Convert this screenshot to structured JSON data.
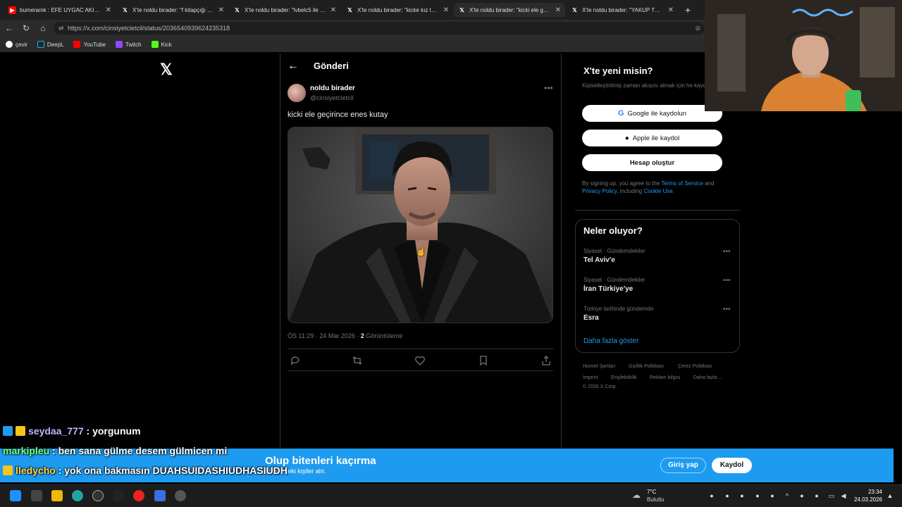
{
  "browser": {
    "tabs": [
      {
        "label": "bumeramk : EFE UYGAC AKIMI TEK",
        "icon": "youtube-icon"
      },
      {
        "label": "X'te noldu birader: \"f kitapçığı ...",
        "icon": "x-icon"
      },
      {
        "label": "X'te noldu birader: \"lvbelc5 ile kon",
        "icon": "x-icon"
      },
      {
        "label": "X'te noldu birader: \"kicke kız tayfa",
        "icon": "x-icon"
      },
      {
        "label": "X'te noldu birader: \"kicki ele geçir",
        "icon": "x-icon"
      },
      {
        "label": "X'te noldu birader: \"YAKUP TV ENL",
        "icon": "x-icon"
      }
    ],
    "new_tab": "+",
    "url": "https://x.com/cinsiyetcietcil/status/2036540939624235318",
    "bookmarks": [
      {
        "label": "çevir",
        "color": "#ffffff"
      },
      {
        "label": "DeepL",
        "color": "#0f2b46"
      },
      {
        "label": "YouTube",
        "color": "#ff0000"
      },
      {
        "label": "Twitch",
        "color": "#9146ff"
      },
      {
        "label": "Kick",
        "color": "#53fc18"
      }
    ]
  },
  "post": {
    "heading": "Gönderi",
    "author_name": "noldu birader",
    "author_handle": "@cinsiyetcietcil",
    "text": "kicki ele geçirince enes kutay",
    "time_date": "ÖS 11:29 · 24 Mar 2026 · ",
    "views_count": "2",
    "views_label": " Görüntüleme"
  },
  "signup": {
    "title": "X'te yeni misin?",
    "desc": "Kişiselleştirilmiş zaman akışını almak için he kaydol!",
    "google_label": "Google ile kaydolun",
    "apple_label": "Apple ile kaydol",
    "create_label": "Hesap oluştur",
    "terms_prefix": "By signing up, you agree to the ",
    "terms_link": "Terms of Service",
    "terms_and": " and ",
    "privacy_link": "Privacy Policy",
    "including": ", including ",
    "cookie_link": "Cookie Use."
  },
  "trends": {
    "title": "Neler oluyor?",
    "items": [
      {
        "category": "Siyaset · Gündemdekiler",
        "name": "Tel Aviv'e"
      },
      {
        "category": "Siyaset · Gündemdekiler",
        "name": "İran Türkiye'ye"
      },
      {
        "category": "Türkiye tarihinde gündemde",
        "name": "Esra"
      }
    ],
    "show_more": "Daha fazla göster"
  },
  "footer": {
    "links": [
      "Hizmet Şartları",
      "Gizlilik Politikası",
      "Çerez Politikası",
      "Imprint",
      "Erişilebilirlik",
      "Reklam bilgisi",
      "Daha fazla ..."
    ],
    "copyright": "© 2026 X Corp."
  },
  "banner": {
    "title": "Olup bitenleri kaçırma",
    "subtitle": "önce X'teki kişiler alır.",
    "login_label": "Giriş yap",
    "register_label": "Kaydol"
  },
  "chat": [
    {
      "user": "seydaa_777",
      "message": " : yorgunum",
      "user_color": "#b9b9ff"
    },
    {
      "user": "markipleu",
      "message": " : ben sana gülme desem gülmicen mi",
      "user_color": "#7cff7c"
    },
    {
      "user": "lledycho",
      "message": " : yok ona bakmasın DUAHSUIDASHIUDHASIUDH",
      "user_color": "#ffd54a"
    }
  ],
  "taskbar": {
    "weather_temp": "7°C",
    "weather_label": "Bulutlu",
    "time": "23:34",
    "date": "24.03.2026"
  },
  "colors": {
    "accent": "#1d9bf0",
    "background": "#000000",
    "border": "#2f3336",
    "muted_text": "#71767b"
  }
}
